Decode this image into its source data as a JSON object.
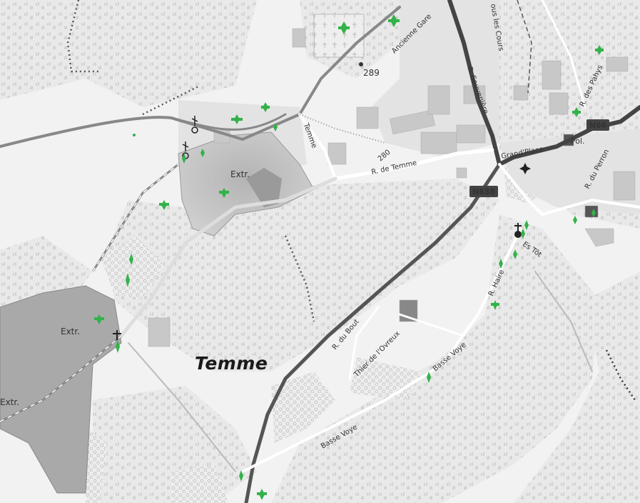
{
  "map": {
    "place_name": "Temme",
    "colors": {
      "background": "#f2f2f2",
      "built_area": "#e3e3e3",
      "building": "#c8c8c8",
      "quarry": "#a9a9a9",
      "main_road": "#777777",
      "national_road": "#555555",
      "minor_road": "#ffffff",
      "tree_marker": "#33b24a"
    },
    "labels": {
      "extr_center": "Extr.",
      "extr_left": "Extr.",
      "extr_edge": "Extr.",
      "r_de_temme": "R. de Temme",
      "temme_street": "Temme",
      "ancienne_gare": "Ancienne Gare",
      "sous_les_cours": "ous les Cours",
      "r_sauveniere": "R. Sauvenière",
      "r_des_pahys": "R. des Pahys",
      "r_du_perron": "R. du Perron",
      "grand_place": "Grand'Place",
      "pol": "Pol.",
      "es_tot": "Es Tôt",
      "r_haire": "R. Haire",
      "r_du_bout": "R. du Bout",
      "thier_de_lovreux": "Thier de l'Ovreux",
      "basse_voye_upper": "Basse Voye",
      "basse_voye_lower": "Basse Voye",
      "elev_289": "289",
      "elev_280": "280"
    },
    "road_shields": {
      "n66": "N66",
      "n638": "N638"
    },
    "icons": [
      "tree-marker-icon",
      "church-cross-icon",
      "wayside-cross-icon",
      "viewpoint-star-icon",
      "map-pin-icon"
    ]
  }
}
